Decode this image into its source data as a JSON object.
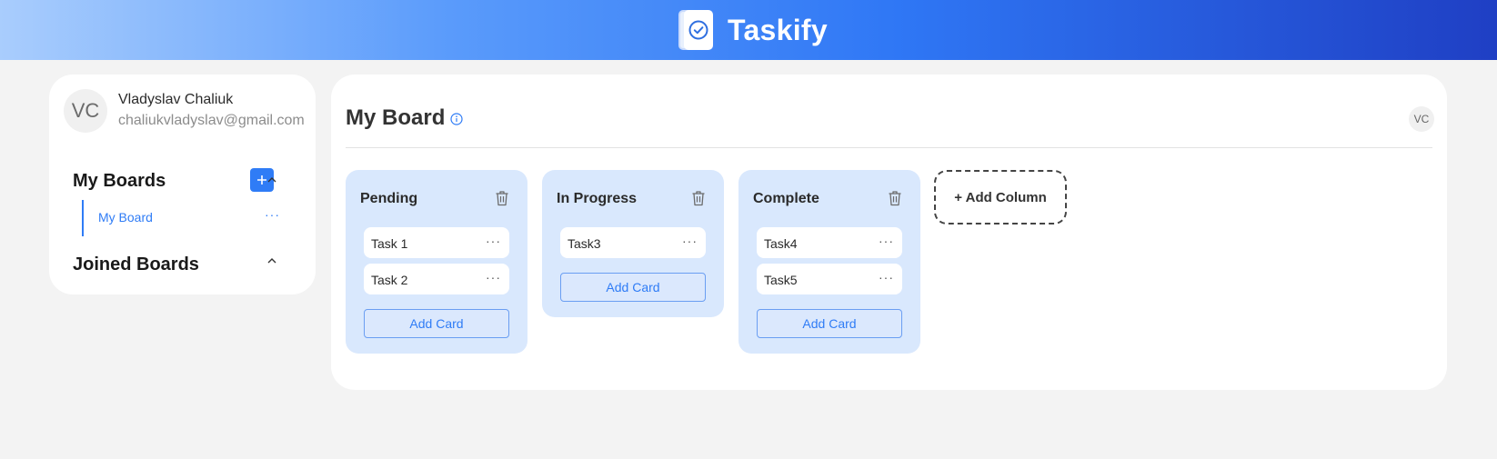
{
  "header": {
    "app_name": "Taskify",
    "logo_icon": "clipboard-check-icon"
  },
  "profile": {
    "initials": "VC",
    "name": "Vladyslav Chaliuk",
    "email": "chaliukvladyslav@gmail.com"
  },
  "sidebar": {
    "my_boards_title": "My Boards",
    "add_icon": "+",
    "boards": [
      {
        "label": "My Board",
        "more": "···"
      }
    ],
    "joined_boards_title": "Joined Boards"
  },
  "board": {
    "title": "My Board",
    "member_initials": "VC",
    "columns": [
      {
        "title": "Pending",
        "cards": [
          {
            "label": "Task 1"
          },
          {
            "label": "Task 2"
          }
        ],
        "add_card_label": "Add Card"
      },
      {
        "title": "In Progress",
        "cards": [
          {
            "label": "Task3"
          }
        ],
        "add_card_label": "Add Card"
      },
      {
        "title": "Complete",
        "cards": [
          {
            "label": "Task4"
          },
          {
            "label": "Task5"
          }
        ],
        "add_card_label": "Add Card"
      }
    ],
    "card_more": "···",
    "add_column_label": "+ Add Column"
  },
  "colors": {
    "accent": "#2f7cf6",
    "column_bg": "#d9e8fd",
    "page_bg": "#f3f3f3"
  }
}
